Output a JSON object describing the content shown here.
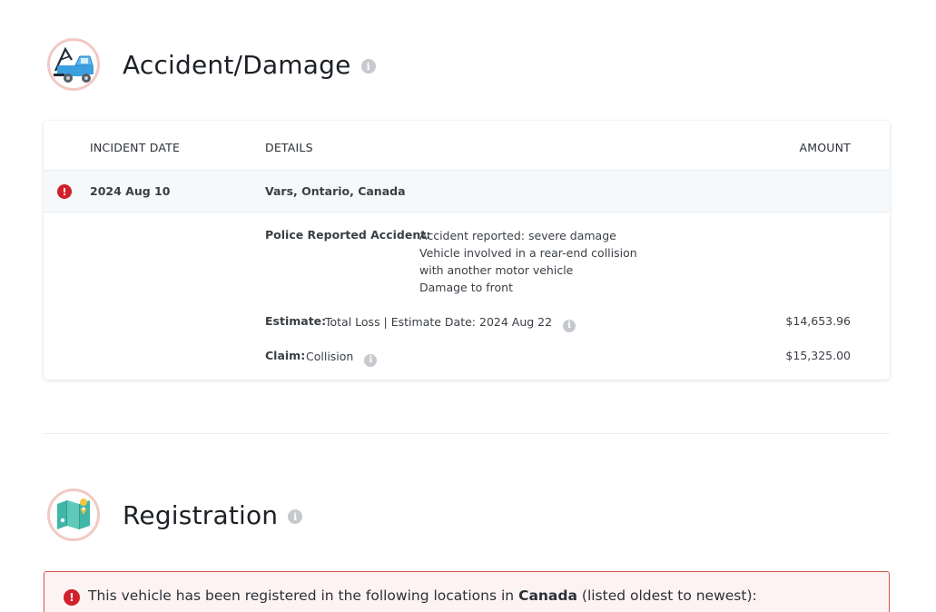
{
  "accident_section": {
    "title": "Accident/Damage",
    "icon": "tow-truck-icon",
    "columns": {
      "date": "INCIDENT DATE",
      "details": "DETAILS",
      "amount": "AMOUNT"
    },
    "incident": {
      "date": "2024 Aug 10",
      "location": "Vars, Ontario, Canada",
      "police_label": "Police Reported Accident:",
      "police_lines": [
        "Accident reported: severe damage",
        "Vehicle involved in a rear-end collision",
        "with another motor vehicle",
        "Damage to front"
      ],
      "estimate_label": "Estimate:",
      "estimate_value": "Total Loss | Estimate Date: 2024 Aug 22",
      "estimate_amount": "$14,653.96",
      "claim_label": "Claim:",
      "claim_value": "Collision",
      "claim_amount": "$15,325.00"
    }
  },
  "registration_section": {
    "title": "Registration",
    "icon": "map-icon",
    "alert_prefix": "This vehicle has been registered in the following locations in",
    "alert_country": "Canada",
    "alert_suffix": "(listed oldest to newest):"
  },
  "colors": {
    "alert_red": "#d0202a",
    "badge_ring": "#f2c9c4",
    "row_highlight": "#f6f9fc"
  }
}
